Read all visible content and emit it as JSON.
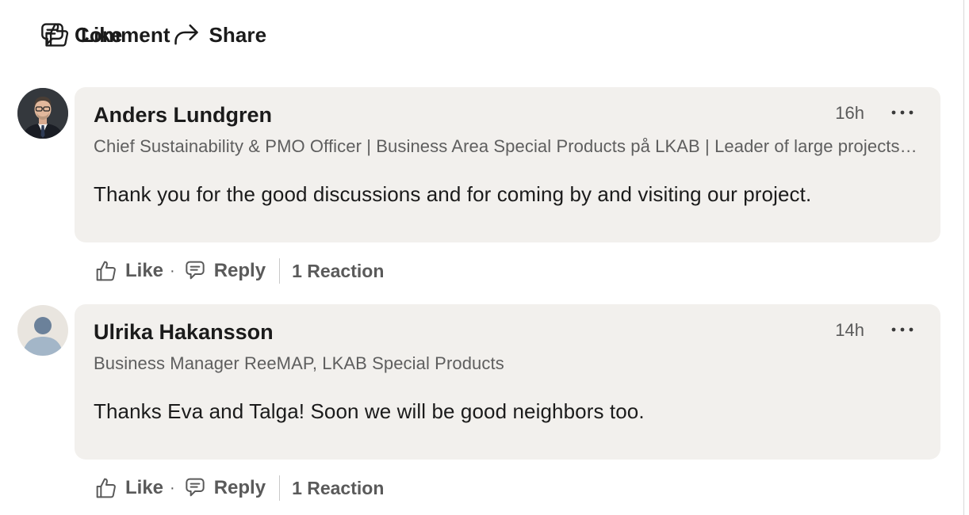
{
  "actions": {
    "like": "Like",
    "comment": "Comment",
    "share": "Share"
  },
  "comments": [
    {
      "author": "Anders Lundgren",
      "headline": "Chief Sustainability & PMO Officer | Business Area Special Products på LKAB | Leader of large projects and programs",
      "time": "16h",
      "text": "Thank you for the good discussions and for coming by and visiting our project.",
      "like_label": "Like",
      "reply_label": "Reply",
      "reactions": "1 Reaction",
      "avatar": "photo"
    },
    {
      "author": "Ulrika Hakansson",
      "headline": "Business Manager ReeMAP, LKAB Special Products",
      "time": "14h",
      "text": "Thanks Eva and Talga! Soon we will be good neighbors too.",
      "like_label": "Like",
      "reply_label": "Reply",
      "reactions": "1 Reaction",
      "avatar": "default-person"
    }
  ],
  "colors": {
    "bubble": "#f2f0ed",
    "text": "#1b1b1b",
    "muted": "#5e5e5e"
  }
}
